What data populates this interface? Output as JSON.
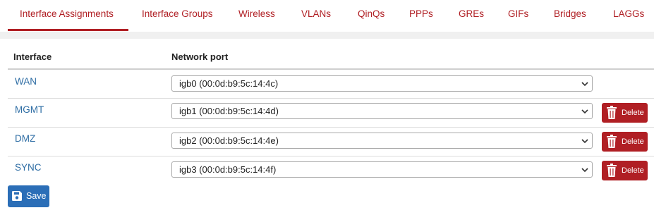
{
  "tabs": [
    {
      "label": "Interface Assignments",
      "active": true
    },
    {
      "label": "Interface Groups"
    },
    {
      "label": "Wireless"
    },
    {
      "label": "VLANs"
    },
    {
      "label": "QinQs"
    },
    {
      "label": "PPPs"
    },
    {
      "label": "GREs"
    },
    {
      "label": "GIFs"
    },
    {
      "label": "Bridges"
    },
    {
      "label": "LAGGs"
    }
  ],
  "table": {
    "headers": {
      "interface": "Interface",
      "port": "Network port"
    },
    "rows": [
      {
        "interface": "WAN",
        "port": "igb0 (00:0d:b9:5c:14:4c)",
        "delete": null
      },
      {
        "interface": "MGMT",
        "port": "igb1 (00:0d:b9:5c:14:4d)",
        "delete": "Delete"
      },
      {
        "interface": "DMZ",
        "port": "igb2 (00:0d:b9:5c:14:4e)",
        "delete": "Delete"
      },
      {
        "interface": "SYNC",
        "port": "igb3 (00:0d:b9:5c:14:4f)",
        "delete": "Delete"
      }
    ]
  },
  "save_label": "Save",
  "colors": {
    "accent": "#b01f24",
    "link": "#2e6da4",
    "save": "#2b6eb7"
  },
  "icons": {
    "delete": "trash-icon",
    "save": "floppy-disk-icon",
    "select": "chevron-down-icon"
  }
}
